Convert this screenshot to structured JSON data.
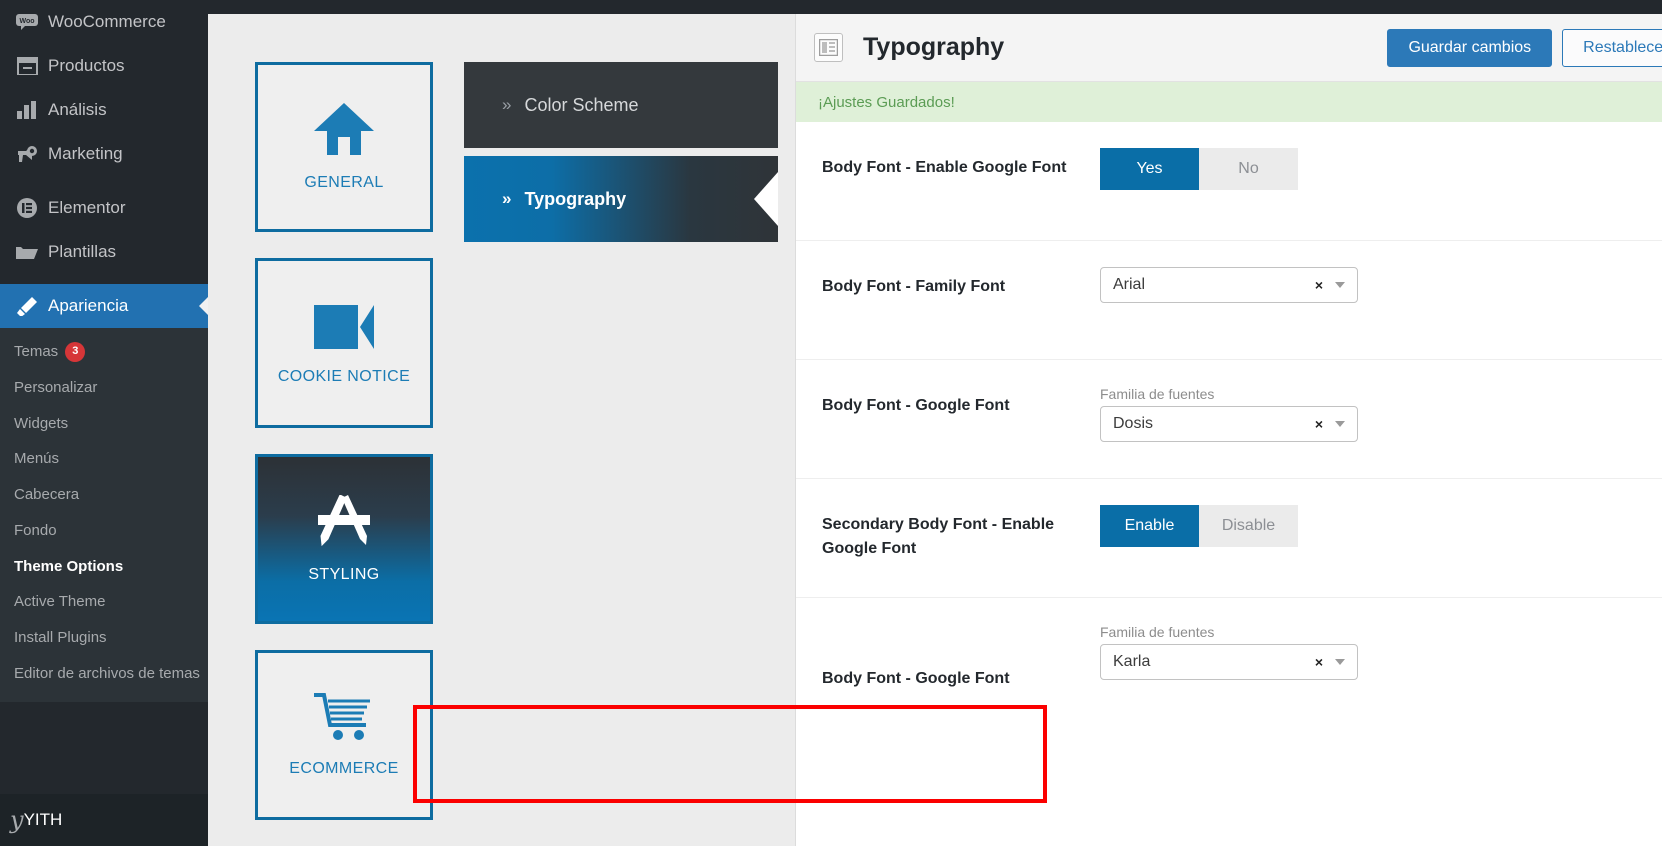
{
  "sidebar": {
    "items": [
      {
        "label": "WooCommerce",
        "icon": "woo-icon"
      },
      {
        "label": "Productos",
        "icon": "products-icon"
      },
      {
        "label": "Análisis",
        "icon": "analytics-bar-chart-icon"
      },
      {
        "label": "Marketing",
        "icon": "megaphone-icon"
      },
      {
        "label": "Elementor",
        "icon": "elementor-icon"
      },
      {
        "label": "Plantillas",
        "icon": "folder-icon"
      }
    ],
    "active_item": {
      "label": "Apariencia",
      "icon": "paintbrush-icon"
    },
    "submenu": [
      {
        "label": "Temas",
        "badge": "3",
        "current": false
      },
      {
        "label": "Personalizar",
        "badge": "",
        "current": false
      },
      {
        "label": "Widgets",
        "badge": "",
        "current": false
      },
      {
        "label": "Menús",
        "badge": "",
        "current": false
      },
      {
        "label": "Cabecera",
        "badge": "",
        "current": false
      },
      {
        "label": "Fondo",
        "badge": "",
        "current": false
      },
      {
        "label": "Theme Options",
        "badge": "",
        "current": true
      },
      {
        "label": "Active Theme",
        "badge": "",
        "current": false
      },
      {
        "label": "Install Plugins",
        "badge": "",
        "current": false
      },
      {
        "label": "Editor de archivos de temas",
        "badge": "",
        "current": false
      }
    ],
    "bottom_item": {
      "label": "YITH",
      "icon": "yith-icon",
      "glyph": "y"
    }
  },
  "sections": [
    {
      "label": "GENERAL",
      "icon": "home-icon",
      "active": false
    },
    {
      "label": "COOKIE NOTICE",
      "icon": "video-camera-icon",
      "active": false
    },
    {
      "label": "STYLING",
      "icon": "pen-brush-icon",
      "active": true
    },
    {
      "label": "ECOMMERCE",
      "icon": "shopping-cart-icon",
      "active": false
    }
  ],
  "subnav": [
    {
      "label": "Color Scheme",
      "marker": "»",
      "current": false
    },
    {
      "label": "Typography",
      "marker": "»",
      "current": true
    }
  ],
  "panel": {
    "title": "Typography",
    "title_icon": "layout-panel-icon",
    "save_label": "Guardar cambios",
    "reset_label": "Restablecer Secció",
    "notice": "¡Ajustes Guardados!",
    "accent_blue": "#0a6ea7",
    "notice_bg": "#dff0d8",
    "highlight_color": "#fb0000"
  },
  "fields": [
    {
      "label": "Body Font - Enable Google Font",
      "type": "buttonset",
      "options": [
        {
          "text": "Yes",
          "selected": true
        },
        {
          "text": "No",
          "selected": false
        }
      ]
    },
    {
      "label": "Body Font - Family Font",
      "type": "select",
      "sub_label": "",
      "value": "Arial",
      "clear": "×"
    },
    {
      "label": "Body Font - Google Font",
      "type": "select",
      "sub_label": "Familia de fuentes",
      "value": "Dosis",
      "clear": "×"
    },
    {
      "label": "Secondary Body Font - Enable Google Font",
      "type": "buttonset",
      "options": [
        {
          "text": "Enable",
          "selected": true
        },
        {
          "text": "Disable",
          "selected": false
        }
      ]
    },
    {
      "label": "Body Font - Google Font",
      "type": "select",
      "sub_label": "Familia de fuentes",
      "value": "Karla",
      "clear": "×",
      "highlighted": true
    }
  ]
}
